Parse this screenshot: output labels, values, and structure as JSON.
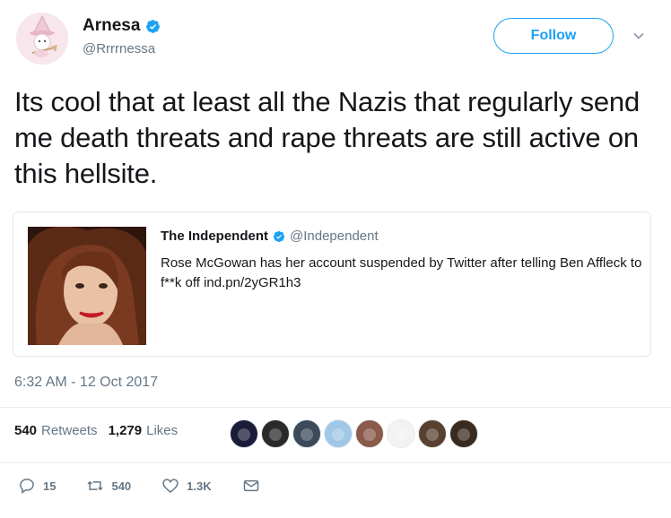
{
  "author": {
    "display_name": "Arnesa",
    "handle": "@Rrrrnessa",
    "verified": true,
    "avatar_icon": "witch-cat-avatar"
  },
  "follow_button": {
    "label": "Follow"
  },
  "more_menu": {
    "icon": "chevron-down-icon"
  },
  "tweet": {
    "text": "Its cool that at least all the Nazis that regularly send me death threats and rape threats are still active on this hellsite."
  },
  "quoted_tweet": {
    "display_name": "The Independent",
    "handle": "@Independent",
    "verified": true,
    "text": "Rose McGowan has her account suspended by Twitter after telling Ben Affleck to f**k off ind.pn/2yGR1h3",
    "image_icon": "portrait-photo"
  },
  "timestamp": "6:32 AM - 12 Oct 2017",
  "stats": {
    "retweets_count": "540",
    "retweets_label": "Retweets",
    "likes_count": "1,279",
    "likes_label": "Likes"
  },
  "likers": [
    {
      "color": "#1b1b3a"
    },
    {
      "color": "#2a2a2a"
    },
    {
      "color": "#3d4a5a"
    },
    {
      "color": "#9fc7e8"
    },
    {
      "color": "#8a5a4a"
    },
    {
      "color": "#f2f2f2"
    },
    {
      "color": "#5a4030"
    },
    {
      "color": "#3a2a20"
    }
  ],
  "actions": {
    "reply_count": "15",
    "retweet_count": "540",
    "like_count": "1.3K"
  },
  "colors": {
    "accent": "#1da1f2",
    "text": "#14171a",
    "muted": "#657786",
    "border": "#e1e8ed"
  }
}
